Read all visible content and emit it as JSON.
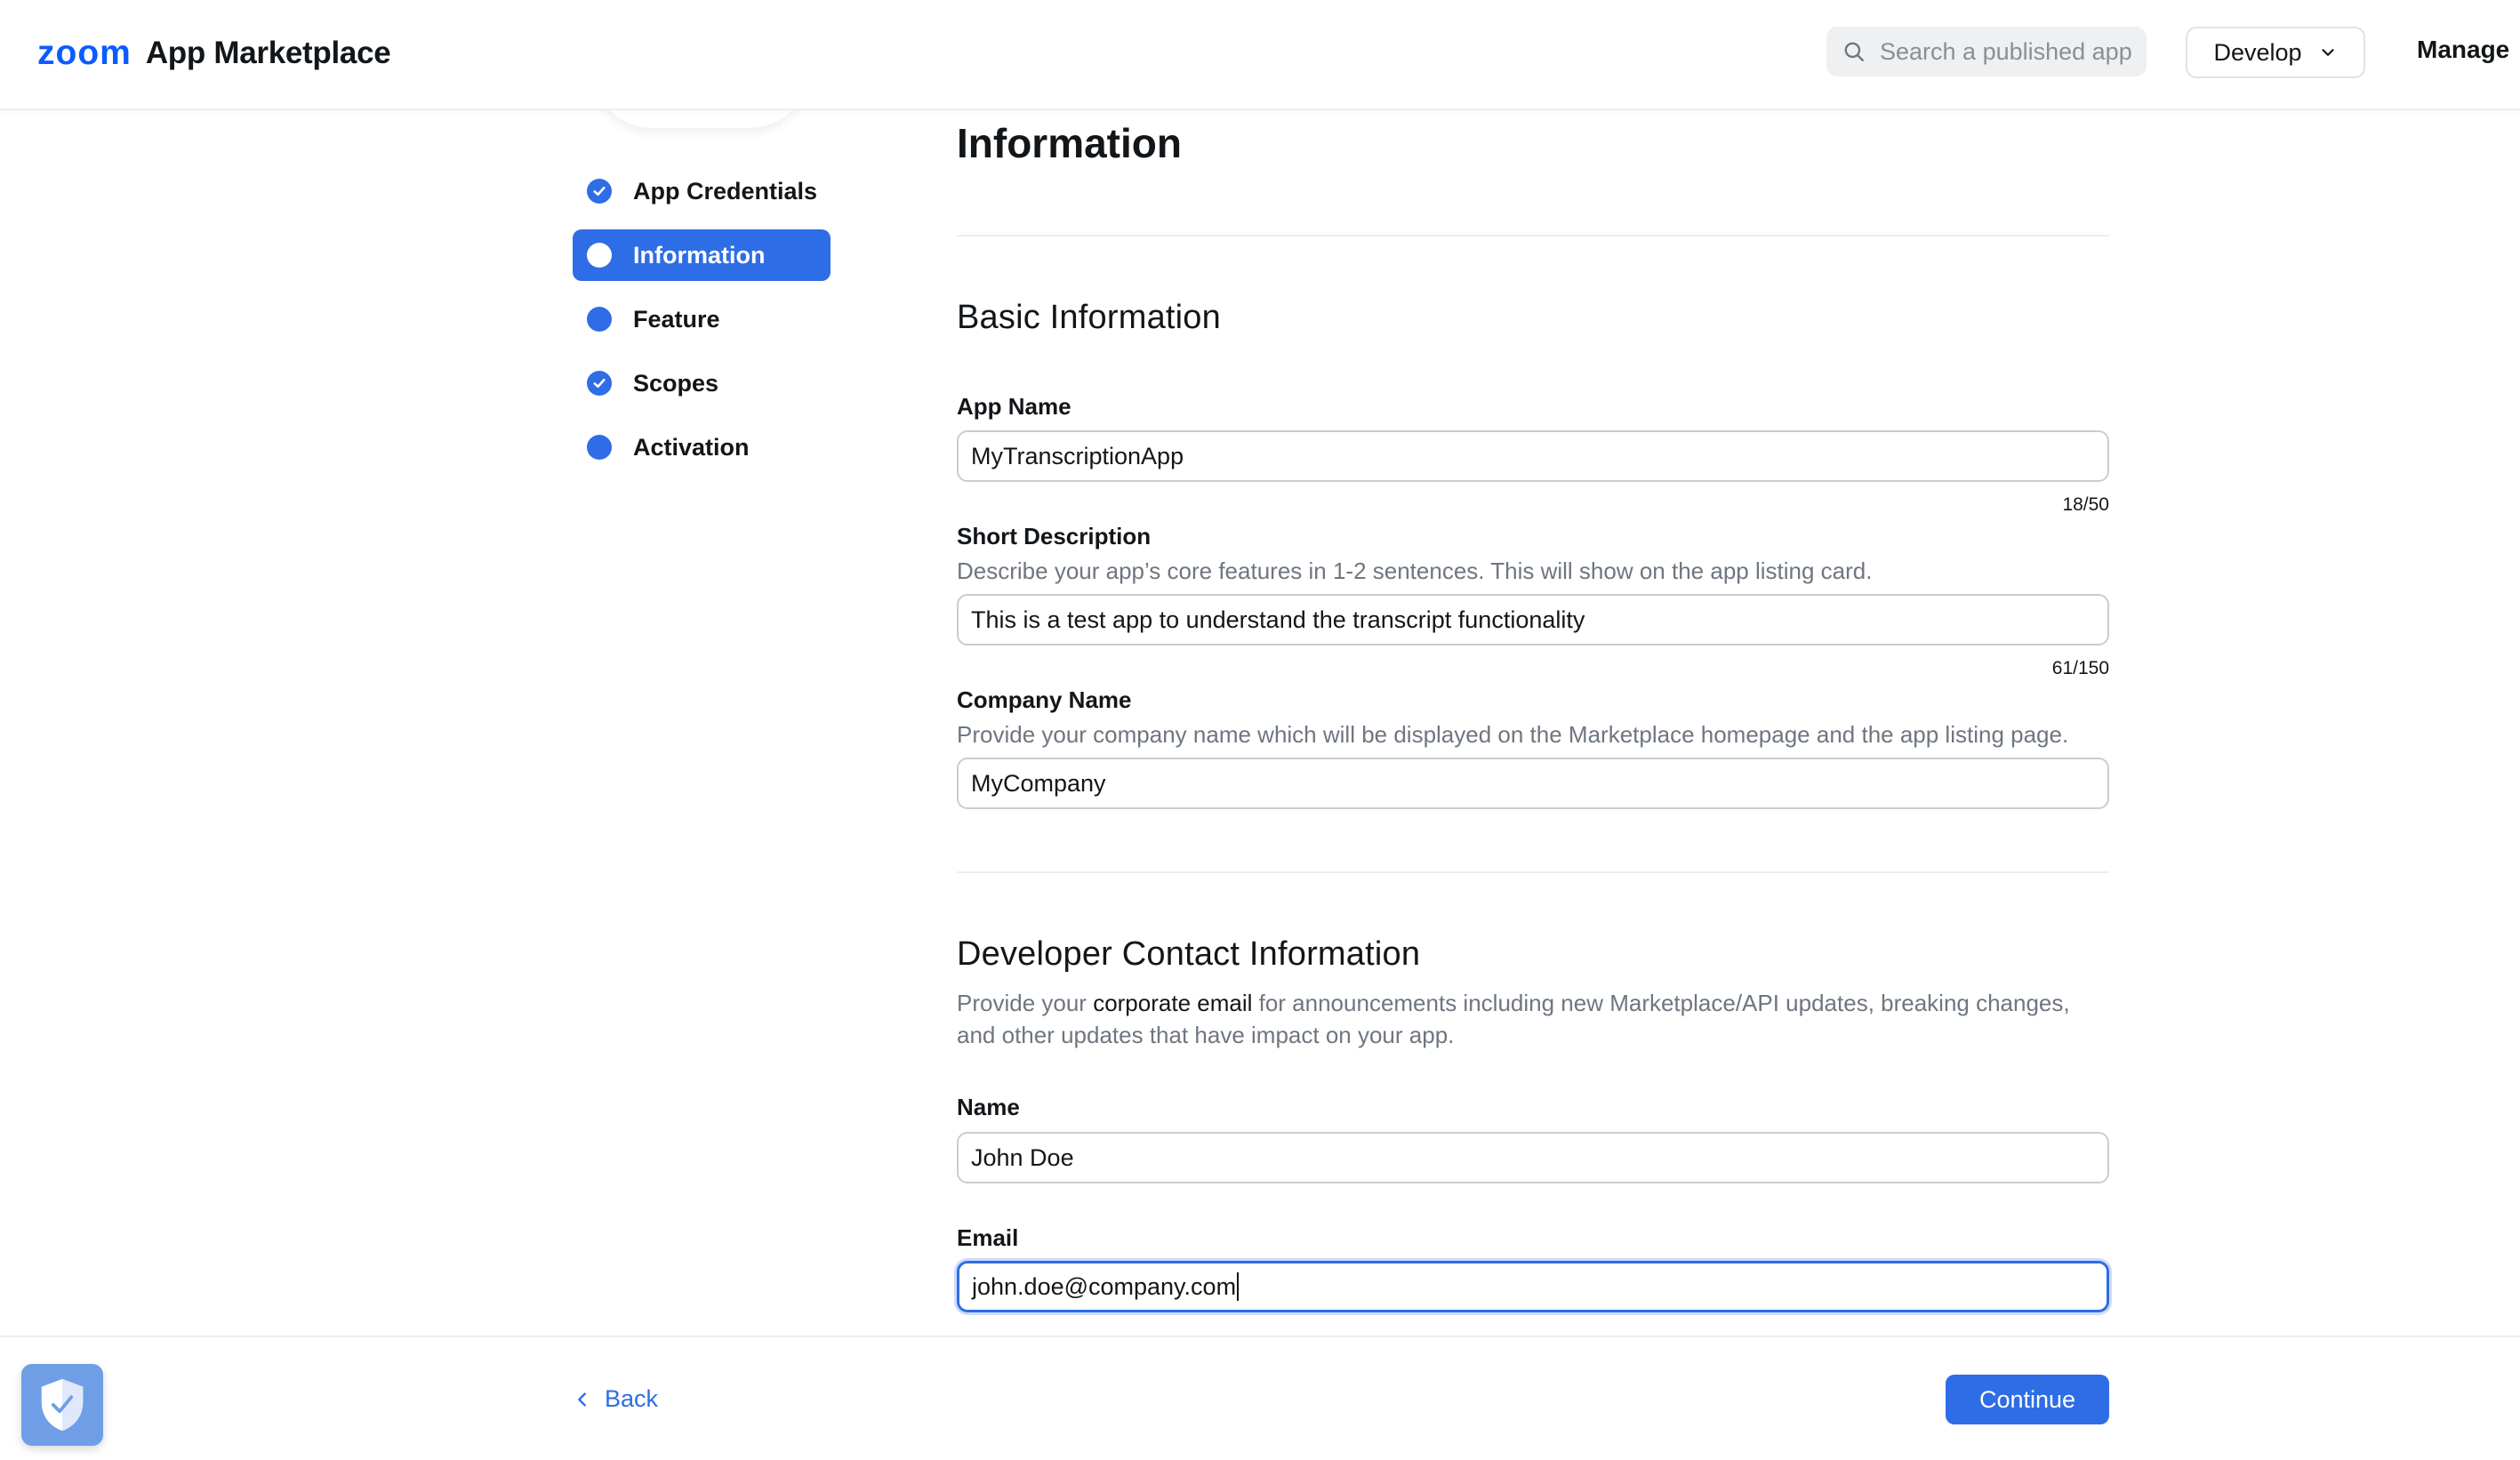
{
  "header": {
    "logo_zoom": "zoom",
    "logo_text": "App Marketplace",
    "search_placeholder": "Search a published app",
    "develop_label": "Develop",
    "manage_label": "Manage"
  },
  "sidebar": {
    "items": [
      {
        "label": "App Credentials",
        "state": "complete",
        "active": false
      },
      {
        "label": "Information",
        "state": "current",
        "active": true
      },
      {
        "label": "Feature",
        "state": "incomplete",
        "active": false
      },
      {
        "label": "Scopes",
        "state": "complete",
        "active": false
      },
      {
        "label": "Activation",
        "state": "incomplete",
        "active": false
      }
    ]
  },
  "main": {
    "page_title": "Information",
    "basic": {
      "title": "Basic Information",
      "app_name": {
        "label": "App Name",
        "value": "MyTranscriptionApp",
        "counter": "18/50"
      },
      "short_description": {
        "label": "Short Description",
        "help": "Describe your app’s core features in 1-2 sentences. This will show on the app listing card.",
        "value": "This is a test app to understand the transcript functionality",
        "counter": "61/150"
      },
      "company_name": {
        "label": "Company Name",
        "help": "Provide your company name which will be displayed on the Marketplace homepage and the app listing page.",
        "value": "MyCompany"
      }
    },
    "developer_contact": {
      "title": "Developer Contact Information",
      "help_prefix": "Provide your ",
      "help_strong": "corporate email",
      "help_suffix": " for announcements including new Marketplace/API updates, breaking changes, and other updates that have impact on your app.",
      "name": {
        "label": "Name",
        "value": "John Doe"
      },
      "email": {
        "label": "Email",
        "value": "john.doe@company.com"
      }
    }
  },
  "footer": {
    "back_label": "Back",
    "continue_label": "Continue"
  },
  "colors": {
    "accent": "#2e6de6",
    "brand": "#0b5cff",
    "shield": "#6f9ee6"
  },
  "icons": [
    "search-icon",
    "chevron-down-icon",
    "check-icon",
    "chevron-left-icon",
    "shield-check-icon"
  ]
}
